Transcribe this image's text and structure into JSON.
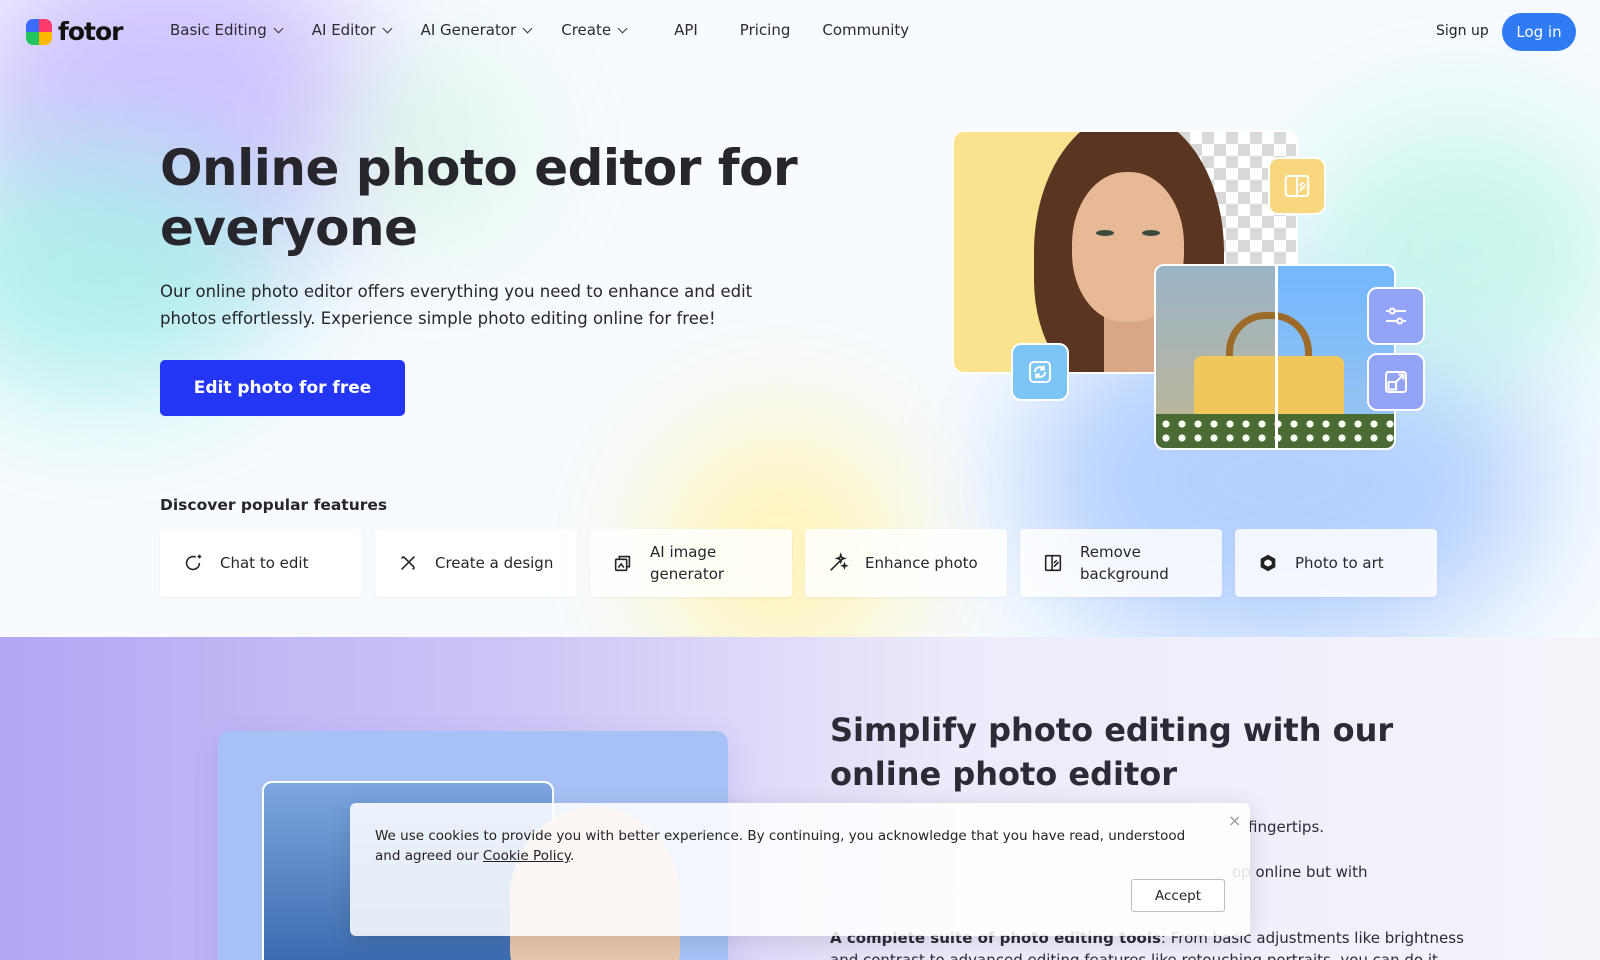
{
  "nav": {
    "logo": "fotor",
    "items": [
      {
        "label": "Basic Editing",
        "dropdown": true
      },
      {
        "label": "AI Editor",
        "dropdown": true
      },
      {
        "label": "AI Generator",
        "dropdown": true
      },
      {
        "label": "Create",
        "dropdown": true
      },
      {
        "label": "API",
        "dropdown": false
      },
      {
        "label": "Pricing",
        "dropdown": false
      },
      {
        "label": "Community",
        "dropdown": false
      }
    ],
    "signup": "Sign up",
    "login": "Log in"
  },
  "hero": {
    "title": "Online photo editor for everyone",
    "lead": "Our online photo editor offers everything you need to enhance and edit photos effortlessly. Experience simple photo editing online for free!",
    "cta": "Edit photo for free"
  },
  "features": {
    "title": "Discover popular features",
    "items": [
      {
        "label": "Chat to edit",
        "icon": "chat-edit-icon"
      },
      {
        "label": "Create a design",
        "icon": "design-icon"
      },
      {
        "label": "AI image generator",
        "icon": "ai-image-icon"
      },
      {
        "label": "Enhance photo",
        "icon": "enhance-icon"
      },
      {
        "label": "Remove background",
        "icon": "remove-bg-icon"
      },
      {
        "label": "Photo to art",
        "icon": "photo-art-icon"
      }
    ]
  },
  "section2": {
    "title": "Simplify photo editing with our online photo editor",
    "p1": "fingertips.",
    "p2": "op online but with",
    "p3_bold": "A complete suite of photo editing tools",
    "p3_rest": ": From basic adjustments like brightness",
    "p4": "and contrast to advanced editing features like retouching portraits, you can do it"
  },
  "cookie": {
    "text": "We use cookies to provide you with better experience. By continuing, you acknowledge that you have read, understood and agreed our ",
    "link": "Cookie Policy",
    "end": ".",
    "accept": "Accept",
    "close": "×"
  },
  "colors": {
    "accent": "#2436f5",
    "login": "#2f7bf6"
  }
}
